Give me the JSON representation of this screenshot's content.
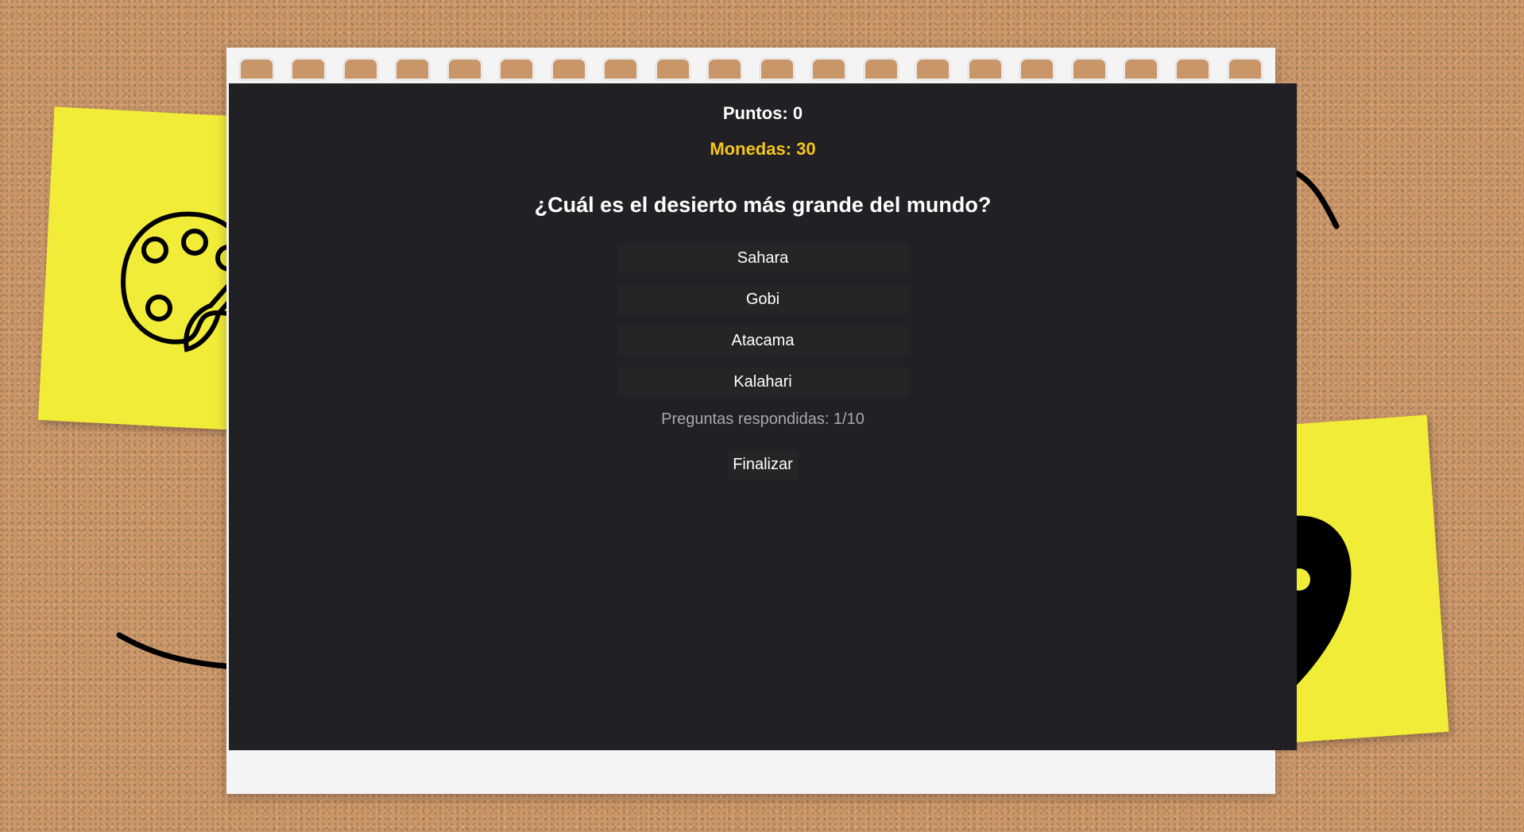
{
  "quiz": {
    "score_text": "Puntos: 0",
    "coins_text": "Monedas: 30",
    "question": "¿Cuál es el desierto más grande del mundo?",
    "options": [
      "Sahara",
      "Gobi",
      "Atacama",
      "Kalahari"
    ],
    "progress_text": "Preguntas respondidas: 1/10",
    "finish_label": "Finalizar"
  },
  "decor": {
    "left_note_icon": "palette-icon",
    "right_note_icon": "location-pin-icon",
    "background": "corkboard",
    "note_color": "#f1ec37",
    "panel_color": "#212125",
    "coins_color": "#f5c518"
  }
}
